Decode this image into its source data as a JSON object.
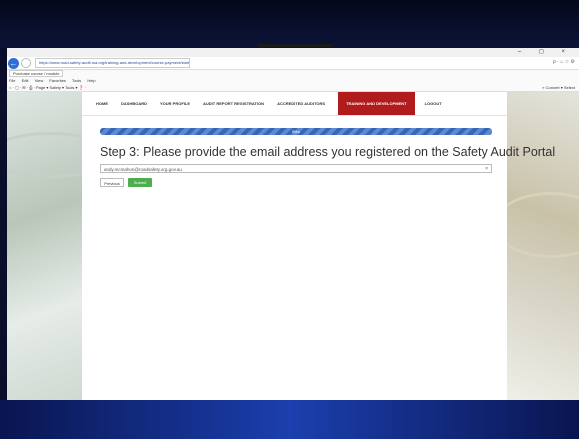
{
  "browser": {
    "address": "https://www.road-safety-audit.rsa.org/training-and-development/course-payment/start",
    "tab_label": "Purchase course / module",
    "window_controls": "– ◻ ×",
    "right_icons": "ρ · ⌂ ☆ ⚙",
    "menu": [
      "File",
      "Edit",
      "View",
      "Favorites",
      "Tools",
      "Help"
    ],
    "commands": "⌂ · ▢ · ✉ · ⎙ · Page ▾  Safety ▾  Tools ▾  ❓ · ",
    "commands_right": "» Convert ▾  Select"
  },
  "nav": {
    "items": [
      {
        "label": "HOME",
        "active": false
      },
      {
        "label": "DASHBOARD",
        "active": false
      },
      {
        "label": "YOUR PROFILE",
        "active": false
      },
      {
        "label": "AUDIT REPORT REGISTRATION",
        "active": false
      },
      {
        "label": "ACCREDITED AUDITORS",
        "active": false
      },
      {
        "label": "TRAINING AND DEVELOPMENT",
        "active": true
      },
      {
        "label": "LOGOUT",
        "active": false
      }
    ]
  },
  "progress": {
    "label": "Step",
    "value_percent": 100
  },
  "step": {
    "title": "Step 3: Please provide the email address you registered on the Safety Audit Portal"
  },
  "email": {
    "value": "andy.mcmahon@roadsafety.org.gov.au"
  },
  "buttons": {
    "previous": "Previous",
    "submit": "Submit"
  },
  "colors": {
    "active_nav": "#b01c1c",
    "submit": "#4cae4c",
    "progress": "#3566b8"
  }
}
